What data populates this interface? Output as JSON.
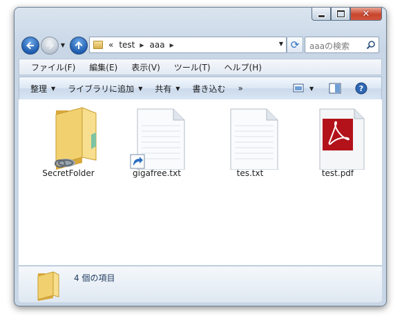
{
  "window": {
    "caption": {
      "minimize": "minimize",
      "maximize": "maximize",
      "close_glyph": "✕"
    }
  },
  "address_bar": {
    "overflow_glyph": "«",
    "breadcrumbs": [
      "test",
      "aaa"
    ],
    "search_placeholder": "aaaの検索"
  },
  "menu": {
    "items": [
      "ファイル(F)",
      "編集(E)",
      "表示(V)",
      "ツール(T)",
      "ヘルプ(H)"
    ]
  },
  "toolbar": {
    "organize": "整理",
    "include_in_library": "ライブラリに追加",
    "share": "共有",
    "burn": "書き込む",
    "overflow": "»"
  },
  "files": [
    {
      "name": "SecretFolder",
      "type": "folder-link"
    },
    {
      "name": "gigafree.txt",
      "type": "text-shortcut"
    },
    {
      "name": "tes.txt",
      "type": "text"
    },
    {
      "name": "test.pdf",
      "type": "pdf"
    }
  ],
  "details_pane": {
    "summary": "4 個の項目"
  },
  "colors": {
    "accent": "#2d70c3",
    "pdf_red": "#b3121a"
  }
}
